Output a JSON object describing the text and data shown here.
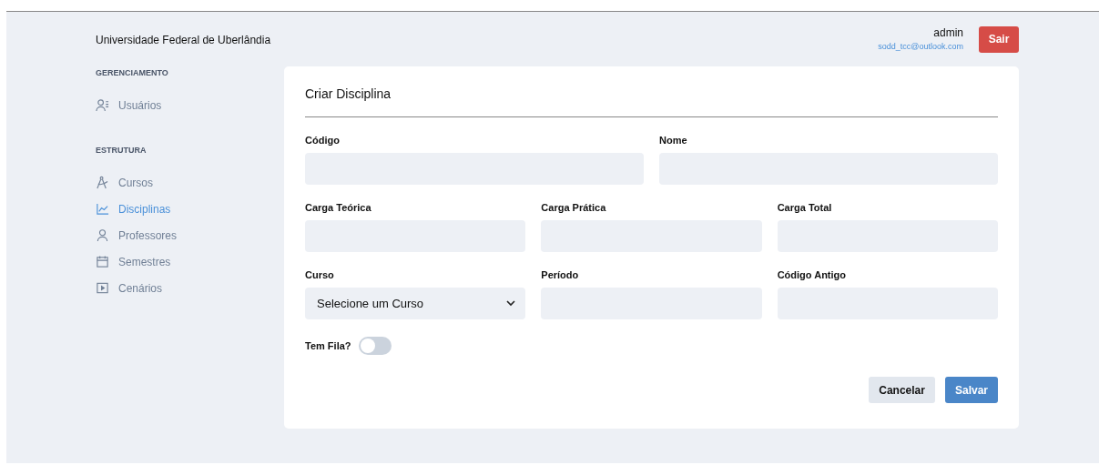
{
  "header": {
    "title": "Universidade Federal de Uberlândia",
    "user_name": "admin",
    "user_email": "sodd_tcc@outlook.com",
    "logout": "Sair"
  },
  "sidebar": [
    {
      "heading": "GERENCIAMENTO",
      "items": [
        {
          "label": "Usuários",
          "kind": "users",
          "selected": false
        }
      ]
    },
    {
      "heading": "ESTRUTURA",
      "items": [
        {
          "label": "Cursos",
          "kind": "compass",
          "selected": false
        },
        {
          "label": "Disciplinas",
          "kind": "chart",
          "selected": true
        },
        {
          "label": "Professores",
          "kind": "person",
          "selected": false
        },
        {
          "label": "Semestres",
          "kind": "calendar",
          "selected": false
        },
        {
          "label": "Cenários",
          "kind": "play",
          "selected": false
        }
      ]
    }
  ],
  "form": {
    "title": "Criar Disciplina",
    "rows": [
      [
        {
          "label": "Código",
          "kind": "text"
        },
        {
          "label": "Nome",
          "kind": "text"
        }
      ],
      [
        {
          "label": "Carga Teórica",
          "kind": "text"
        },
        {
          "label": "Carga Prática",
          "kind": "text"
        },
        {
          "label": "Carga Total",
          "kind": "text"
        }
      ],
      [
        {
          "label": "Curso",
          "kind": "select",
          "value": "Selecione um Curso"
        },
        {
          "label": "Período",
          "kind": "text"
        },
        {
          "label": "Código Antigo",
          "kind": "text"
        }
      ]
    ],
    "toggle": {
      "label": "Tem Fila?",
      "on": false
    },
    "buttons": [
      {
        "label": "Cancelar",
        "kind": "secondary"
      },
      {
        "label": "Salvar",
        "kind": "primary"
      }
    ]
  }
}
